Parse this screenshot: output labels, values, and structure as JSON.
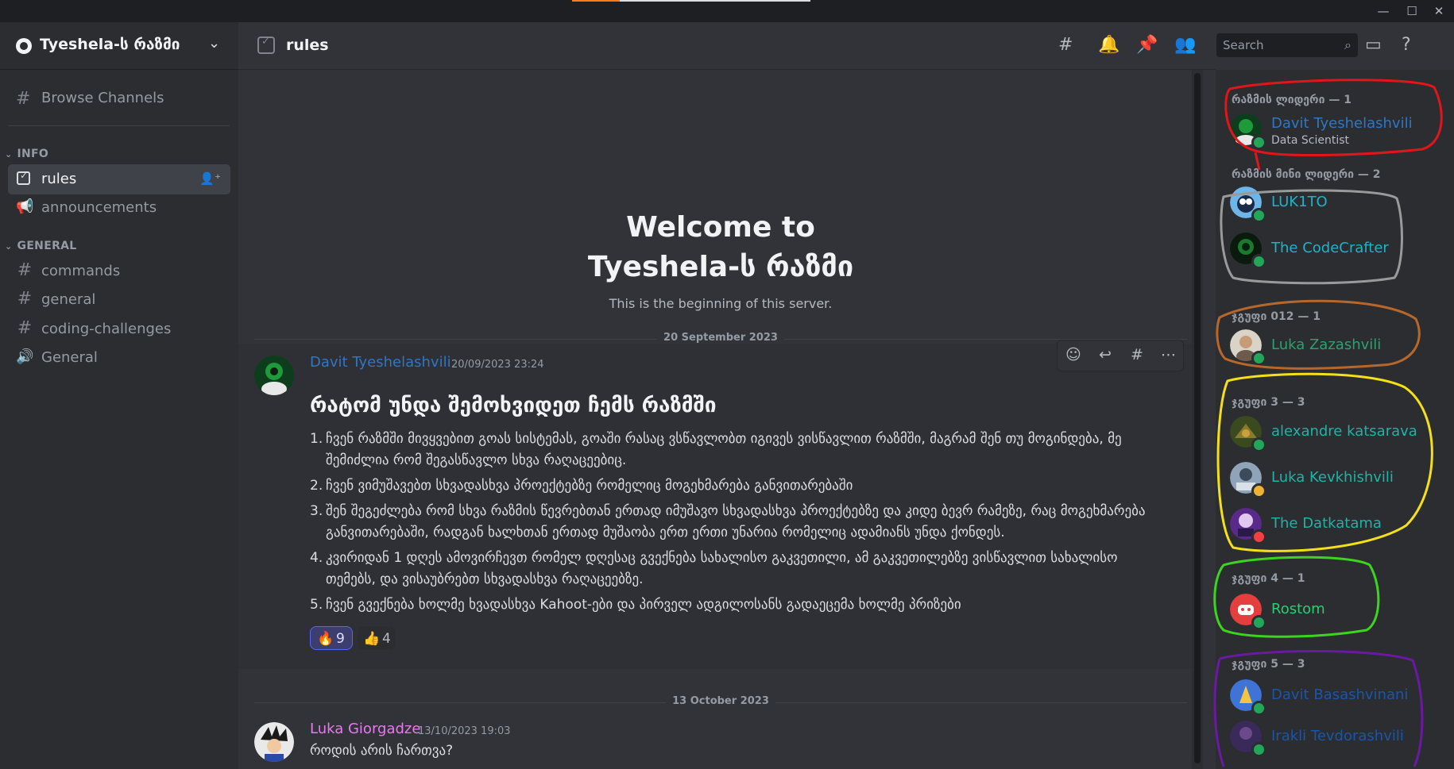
{
  "window": {
    "minimize": "—",
    "maximize": "☐",
    "close": "✕"
  },
  "server": {
    "name": "Tyeshela-ს რაზმი"
  },
  "sidebar": {
    "browse_label": "Browse Channels",
    "categories": [
      {
        "name": "INFO",
        "channels": [
          {
            "name": "rules",
            "type": "rules",
            "active": true
          },
          {
            "name": "announcements",
            "type": "announcement"
          }
        ]
      },
      {
        "name": "GENERAL",
        "channels": [
          {
            "name": "commands",
            "type": "text"
          },
          {
            "name": "general",
            "type": "text"
          },
          {
            "name": "coding-challenges",
            "type": "text"
          },
          {
            "name": "General",
            "type": "voice"
          }
        ]
      }
    ]
  },
  "header": {
    "channel": "rules",
    "search_placeholder": "Search"
  },
  "welcome": {
    "line1": "Welcome to",
    "line2": "Tyeshela-ს რაზმი",
    "subtitle": "This is the beginning of this server."
  },
  "messages": [
    {
      "date": "20 September 2023",
      "author": "Davit Tyeshelashvili",
      "author_color": "#2f77c4",
      "timestamp": "20/09/2023 23:24",
      "heading": "რატომ უნდა შემოხვიდეთ ჩემს რაზმში",
      "items": [
        "ჩვენ რაზმში მივყვებით გოას სისტემას, გოაში რასაც ვსწავლობთ იგივეს ვისწავლით რაზმში, მაგრამ შენ თუ მოგინდება, მე შემიძლია რომ შეგასწავლო სხვა რაღაცეებიც.",
        "ჩვენ ვიმუშავებთ სხვადასხვა პროექტებზე რომელიც მოგეხმარება განვითარებაში",
        "შენ შეგეძლება რომ სხვა რაზმის წევრებთან ერთად იმუშავო სხვადასხვა პროექტებზე და კიდე ბევრ რამეზე, რაც მოგეხმარება განვითარებაში, რადგან ხალხთან ერთად მუშაობა ერთ ერთი უნარია რომელიც ადამიანს უნდა ქონდეს.",
        "კვირიდან 1 დღეს ამოვირჩევთ რომელ დღესაც გვექნება სახალისო გაკვეთილი, ამ გაკვეთილებზე ვისწავლით სახალისო თემებს, და ვისაუბრებთ სხვადასხვა რაღაცეებზე.",
        "ჩვენ გვექნება ხოლმე ხვადასხვა Kahoot-ები და პირველ ადგილოსანს გადაეცემა ხოლმე პრიზები"
      ],
      "reactions": [
        {
          "emoji": "🔥",
          "count": "9",
          "active": true
        },
        {
          "emoji": "👍",
          "count": "4",
          "active": false
        }
      ]
    },
    {
      "date": "13 October 2023",
      "author": "Luka Giorgadze",
      "author_color": "#e67bf0",
      "timestamp": "13/10/2023 19:03",
      "text": "როდის არის ჩართვა?"
    }
  ],
  "members": {
    "groups": [
      {
        "title": "რაზმის ლიდერი — 1",
        "members": [
          {
            "name": "Davit Tyeshelashvili",
            "sub": "Data Scientist",
            "color": "#2f77c4",
            "status": "online"
          }
        ]
      },
      {
        "title": "რაზმის მინი ლიდერი — 2",
        "members": [
          {
            "name": "LUK1TO",
            "color": "#1fb3c9",
            "status": "online"
          },
          {
            "name": "The CodeCrafter",
            "color": "#1fb3c9",
            "status": "online"
          }
        ]
      },
      {
        "title": "ჯგუფი 012 — 1",
        "members": [
          {
            "name": "Luka Zazashvili",
            "color": "#2aa36b",
            "status": "online"
          }
        ]
      },
      {
        "title": "ჯგუფი 3 — 3",
        "members": [
          {
            "name": "alexandre katsarava",
            "color": "#1fb3a5",
            "status": "online"
          },
          {
            "name": "Luka Kevkhishvili",
            "color": "#1fb3a5",
            "status": "idle"
          },
          {
            "name": "The Datkatama",
            "color": "#1fb3a5",
            "status": "dnd"
          }
        ]
      },
      {
        "title": "ჯგუფი 4 — 1",
        "members": [
          {
            "name": "Rostom",
            "color": "#2ecc71",
            "status": "online"
          }
        ]
      },
      {
        "title": "ჯგუფი 5 — 3",
        "members": [
          {
            "name": "Davit Basashvinani",
            "color": "#1a56a8",
            "status": "online"
          },
          {
            "name": "Irakli Tevdorashvili",
            "color": "#1a56a8",
            "status": "online"
          }
        ]
      }
    ]
  }
}
